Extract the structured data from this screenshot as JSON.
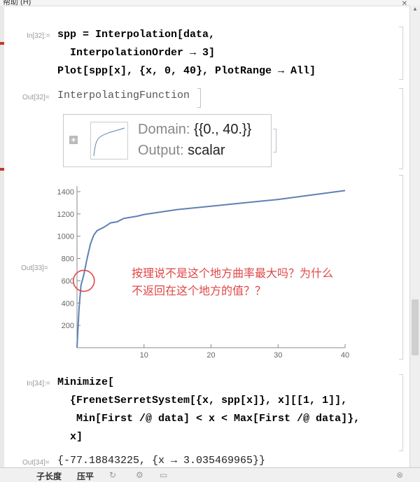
{
  "window": {
    "title": "帮助 (H)"
  },
  "cells": [
    {
      "in_label": "In[32]:=",
      "lines": [
        "spp = Interpolation[data,",
        "  InterpolationOrder → 3]",
        "Plot[spp[x], {x, 0, 40}, PlotRange → All]"
      ]
    },
    {
      "out_label": "Out[32]=",
      "text": "InterpolatingFunction"
    },
    {
      "out_label": "Out[33]="
    },
    {
      "in_label": "In[34]:=",
      "lines": [
        "Minimize[",
        "  {FrenetSerretSystem[{x, spp[x]}, x][[1, 1]],",
        "   Min[First /@ data] < x < Max[First /@ data]},",
        "  x]"
      ]
    },
    {
      "out_label": "Out[34]=",
      "text": "{-77.18843225, {x → 3.035469965}}"
    }
  ],
  "interp": {
    "domain_label": "Domain:",
    "domain_value": "{{0., 40.}}",
    "output_label": "Output:",
    "output_value": "scalar"
  },
  "annotation": {
    "line1": "按理说不是这个地方曲率最大吗？为什么",
    "line2": "不返回在这个地方的值？？"
  },
  "bottom": {
    "item1": "子长度",
    "item2": "压平"
  },
  "chart_data": {
    "type": "line",
    "xlim": [
      0,
      40
    ],
    "ylim": [
      0,
      1450
    ],
    "xticks": [
      10,
      20,
      30,
      40
    ],
    "yticks": [
      200,
      400,
      600,
      800,
      1000,
      1200,
      1400
    ],
    "x": [
      0,
      0.3,
      0.6,
      1,
      1.5,
      2,
      2.5,
      3,
      4,
      5,
      6,
      7,
      8,
      9,
      10,
      15,
      20,
      25,
      30,
      35,
      40
    ],
    "y": [
      0,
      350,
      560,
      650,
      800,
      930,
      1010,
      1050,
      1080,
      1120,
      1130,
      1160,
      1170,
      1180,
      1195,
      1240,
      1270,
      1300,
      1330,
      1370,
      1410
    ],
    "line_color": "#5e81b5",
    "annotation_circle": {
      "x": 0.6,
      "y": 600
    }
  }
}
